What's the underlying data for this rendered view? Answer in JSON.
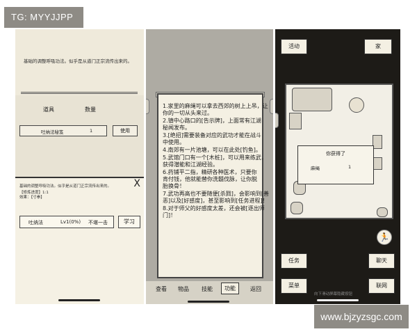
{
  "watermark_tg": "TG: MYYJJPP",
  "watermark_site": "www.bjzyzsgc.com",
  "phone1": {
    "description": "基础的调整呼吸功法。似乎是从道门正宗流传出来的。",
    "col_item": "道具",
    "col_qty": "数量",
    "item_name": "吐纳法秘笈",
    "item_qty": "1",
    "use_label": "使用",
    "dialog": {
      "close_glyph": "X",
      "desc": "基础的调整呼吸功法。似乎是从道门正宗流传出来的。",
      "progress": "【修炼进度】1:1",
      "effect": "效果：【寸拳】",
      "skill_name": "吐纳法",
      "skill_level": "Lv1(0%)",
      "skill_note": "不堪一击",
      "learn_label": "学习"
    }
  },
  "phone2": {
    "tips": [
      "1.家里的麻绳可以拿去西郊的树上上吊，让",
      "你的一切从头来过。",
      "2.镇中心路口的[告示牌]，上面常有江湖",
      "秘闻发布。",
      "3.[绝招]需要装备对应的武功才能在战斗",
      "中使用。",
      "4.南郊有一片池塘，可以在此处[钓鱼]。",
      "5.武馆门口有一个[木桩]，可以用来练武，",
      "获得潜能和江湖经验。",
      "6.药铺平二指，精研各种医术，只要你",
      "肯付钱，他就能替你洗髓伐脉，让你脱",
      "胎换骨！",
      "7.武功再高也不要随便[杀戮]，会影响到[善",
      "恶]以及[好感度]，甚至影响到[任务进程]！",
      "8.对于师父的好感度太差，还会被[逐出师",
      "门]！"
    ],
    "nav": [
      "查看",
      "物品",
      "技能",
      "功能",
      "返回"
    ],
    "nav_active": "功能"
  },
  "phone3": {
    "activity_label": "活动",
    "home_label": "家",
    "popup_title": "你获得了",
    "popup_item": "麻绳",
    "popup_qty": "1",
    "task_label": "任务",
    "chat_label": "聊天",
    "menu_label": "菜单",
    "network_label": "联网",
    "hint": "向下滑动屏幕隐藏按钮",
    "runner_icon": "running-figure-icon"
  }
}
